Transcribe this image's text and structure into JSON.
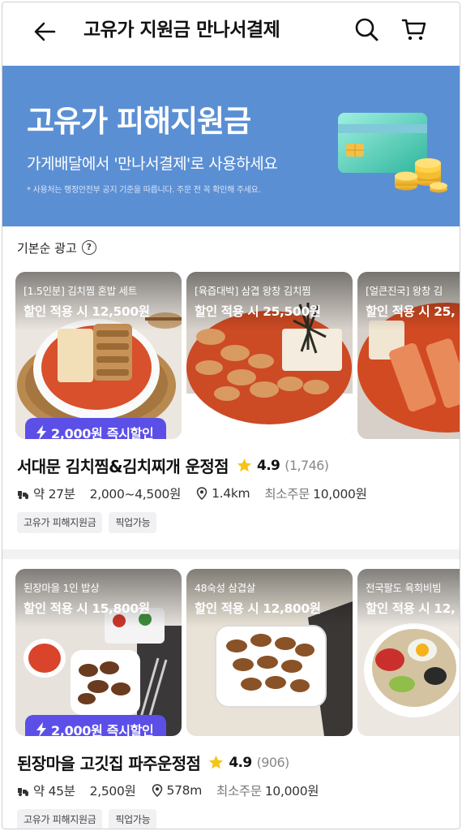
{
  "header": {
    "title": "고유가 지원금 만나서결제"
  },
  "banner": {
    "title": "고유가 피해지원금",
    "subtitle": "가게배달에서 '만나서결제'로 사용하세요",
    "note": "* 사용처는 행정안전부 공지 기준을 따릅니다. 주문 전 꼭 확인해 주세요."
  },
  "sort": {
    "label": "기본순 광고",
    "help": "?"
  },
  "stores": [
    {
      "name": "서대문 김치찜&김치찌개 운정점",
      "rating": "4.9",
      "reviews": "(1,746)",
      "coupon": "2,000원 즉시할인",
      "delivery_time": "약 27분",
      "delivery_fee": "2,000~4,500원",
      "distance": "1.4km",
      "min_order_label": "최소주문",
      "min_order": "10,000원",
      "tags": [
        "고유가 피해지원금",
        "픽업가능"
      ],
      "menus": [
        {
          "name": "[1.5인분] 김치찜 혼밥 세트",
          "price": "할인 적용 시 12,500원"
        },
        {
          "name": "[육즙대박] 삼겹 왕창 김치찜",
          "price": "할인 적용 시 25,500원"
        },
        {
          "name": "[얼큰진국] 왕창 김",
          "price": "할인 적용 시 25,"
        }
      ]
    },
    {
      "name": "된장마을 고깃집 파주운정점",
      "rating": "4.9",
      "reviews": "(906)",
      "coupon": "2,000원 즉시할인",
      "delivery_time": "약 45분",
      "delivery_fee": "2,500원",
      "distance": "578m",
      "min_order_label": "최소주문",
      "min_order": "10,000원",
      "tags": [
        "고유가 피해지원금",
        "픽업가능"
      ],
      "menus": [
        {
          "name": "된장마을 1인 밥상",
          "price": "할인 적용 시 15,800원"
        },
        {
          "name": "48숙성 삼겹살",
          "price": "할인 적용 시 12,800원"
        },
        {
          "name": "전국팔도 육회비빔",
          "price": "할인 적용 시 12,"
        }
      ]
    }
  ],
  "colors": {
    "banner": "#5b8fd4",
    "coupon": "#5b4fe8",
    "star": "#f5c518"
  }
}
